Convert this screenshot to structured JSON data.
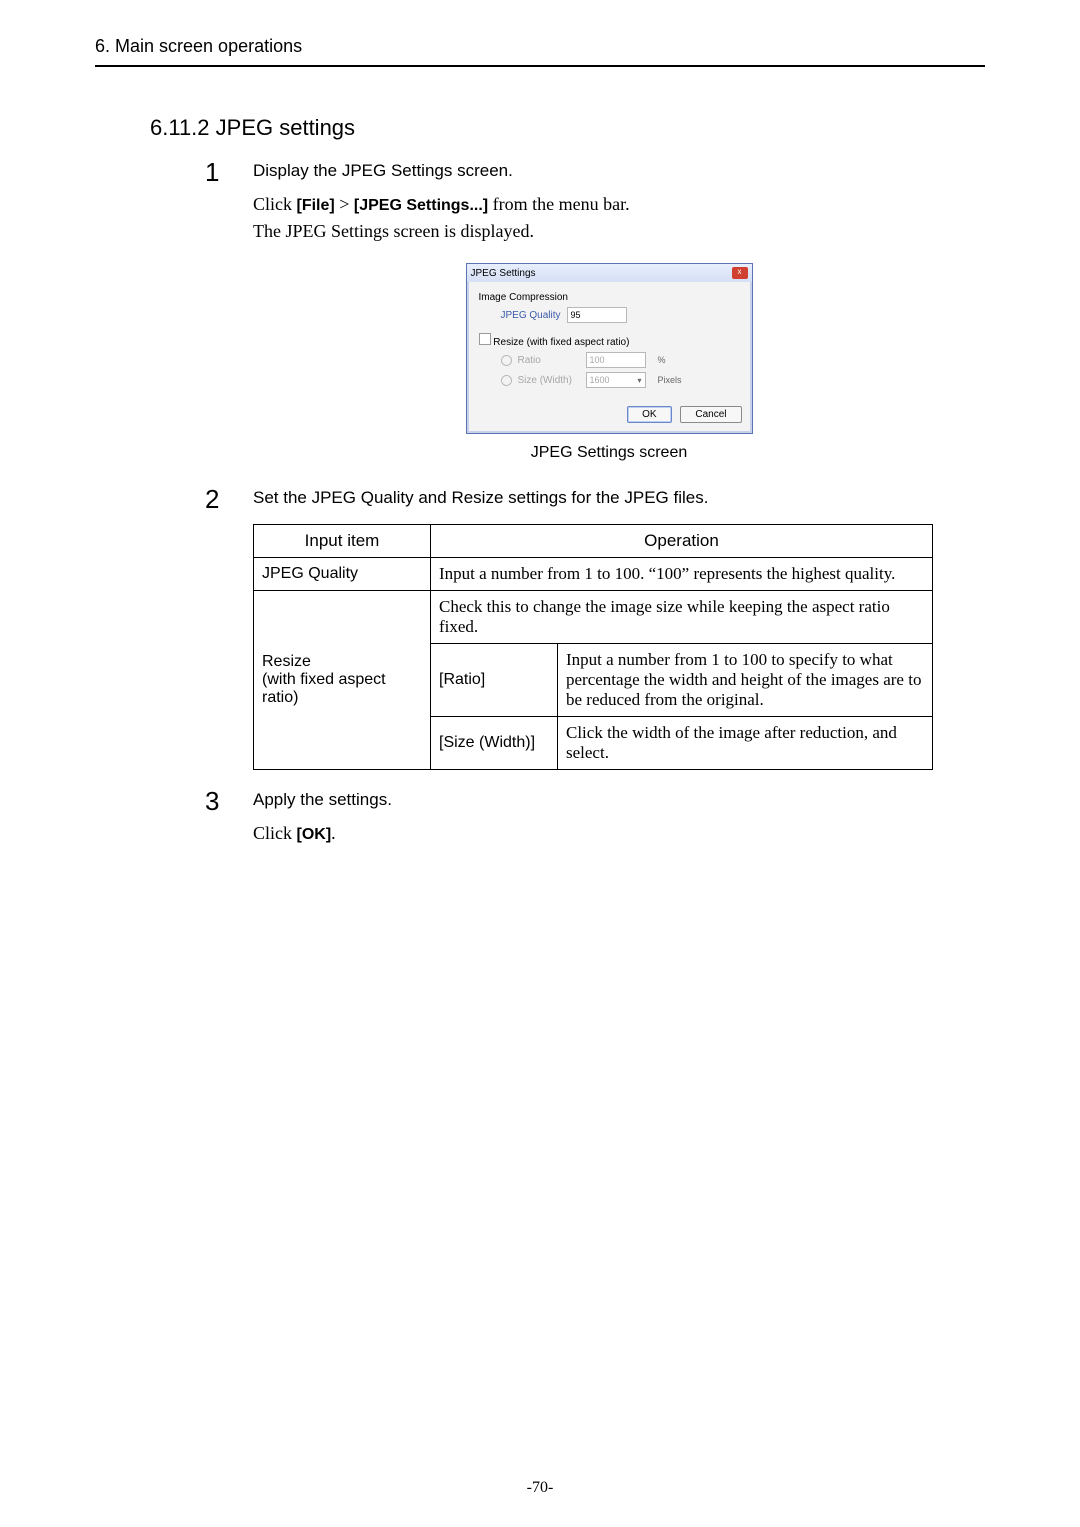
{
  "header": {
    "text": "6. Main screen operations"
  },
  "section": {
    "title": "6.11.2 JPEG settings"
  },
  "steps": [
    {
      "num": "1",
      "heading": "Display the JPEG Settings screen.",
      "line1_pre": "Click ",
      "line1_b1": "[File]",
      "line1_mid": " > ",
      "line1_b2": "[JPEG Settings...]",
      "line1_post": " from the menu bar.",
      "line2": "The JPEG Settings screen is displayed."
    },
    {
      "num": "2",
      "heading": "Set the JPEG Quality and Resize settings for the JPEG files."
    },
    {
      "num": "3",
      "heading": "Apply the settings.",
      "line1_pre": "Click ",
      "line1_b1": "[OK]",
      "line1_post": "."
    }
  ],
  "dialog": {
    "title": "JPEG Settings",
    "group1_title": "Image Compression",
    "quality_label": "JPEG Quality",
    "quality_value": "95",
    "resize_check_label": "Resize (with fixed aspect ratio)",
    "ratio_label": "Ratio",
    "ratio_value": "100",
    "ratio_suffix": "%",
    "size_label": "Size (Width)",
    "size_value": "1600",
    "size_suffix": "Pixels",
    "ok": "OK",
    "cancel": "Cancel"
  },
  "figure_caption": "JPEG Settings screen",
  "table": {
    "h1": "Input item",
    "h2": "Operation",
    "r1c1": "JPEG Quality",
    "r1c2": "Input a number from 1 to 100.  “100” represents the highest quality.",
    "r2c1": "Resize\n(with fixed aspect ratio)",
    "r2_span": "Check this to change the image size while keeping the aspect ratio fixed.",
    "r3c1": "[Ratio]",
    "r3c2": "Input a number from 1 to 100 to specify to what percentage the width and height of the images are to be reduced from the original.",
    "r4c1": "[Size (Width)]",
    "r4c2": "Click the width of the image after reduction, and select."
  },
  "footer": {
    "page": "-70-"
  }
}
